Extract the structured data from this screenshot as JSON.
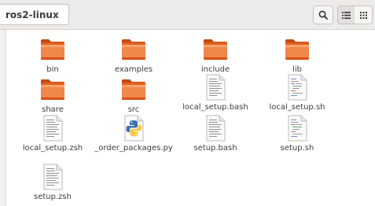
{
  "window": {
    "title": "ros2-linux"
  },
  "toolbar": {
    "icons": [
      "search-icon",
      "list-view-icon",
      "grid-view-icon"
    ]
  },
  "colors": {
    "folder_orange": "#e95f1f",
    "folder_light": "#f3944a",
    "header_bg": "#edebe9"
  },
  "files": [
    {
      "name": "bin",
      "type": "folder"
    },
    {
      "name": "examples",
      "type": "folder"
    },
    {
      "name": "include",
      "type": "folder"
    },
    {
      "name": "lib",
      "type": "folder"
    },
    {
      "name": "share",
      "type": "folder"
    },
    {
      "name": "src",
      "type": "folder"
    },
    {
      "name": "local_setup.bash",
      "type": "text-file"
    },
    {
      "name": "local_setup.sh",
      "type": "script-file"
    },
    {
      "name": "local_setup.zsh",
      "type": "text-file"
    },
    {
      "name": "_order_packages.py",
      "type": "python-file"
    },
    {
      "name": "setup.bash",
      "type": "text-file"
    },
    {
      "name": "setup.sh",
      "type": "script-file"
    },
    {
      "name": "setup.zsh",
      "type": "text-file"
    }
  ]
}
